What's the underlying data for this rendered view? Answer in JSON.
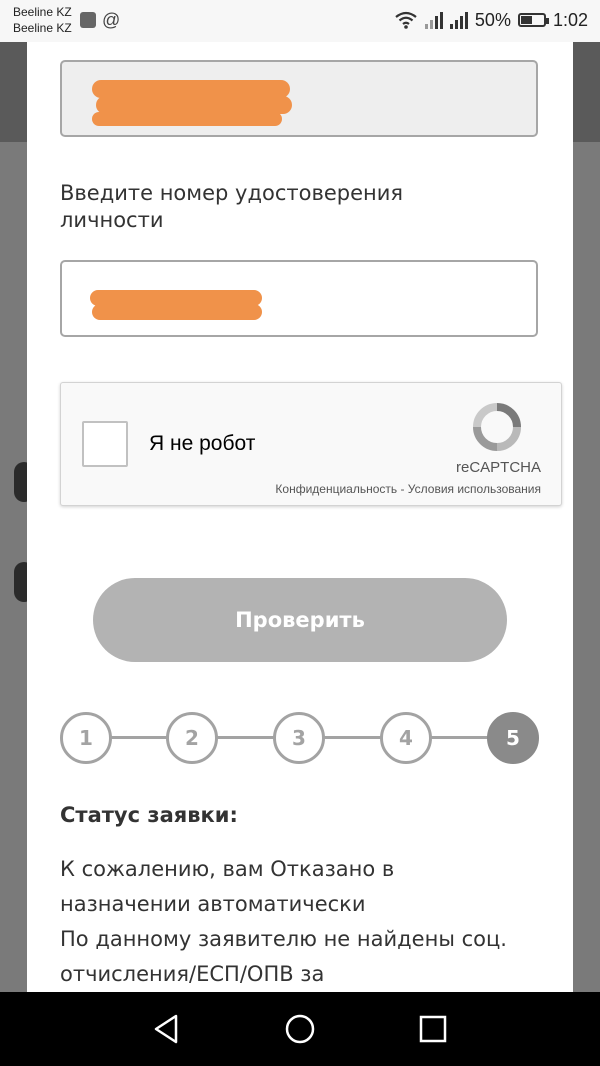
{
  "status_bar": {
    "carrier_1": "Beeline KZ",
    "carrier_2": "Beeline KZ",
    "at_symbol": "@",
    "battery_percent": "50%",
    "battery_level": 0.5,
    "time": "1:02",
    "icons": [
      "shield-icon",
      "wifi-icon",
      "cell-signal-icon",
      "battery-icon"
    ]
  },
  "form": {
    "id_label": "Введите номер удостоверения личности"
  },
  "captcha": {
    "label": "Я не робот",
    "brand": "reCAPTCHA",
    "links": "Конфиденциальность - Условия использования",
    "checked": false
  },
  "check_button": {
    "label": "Проверить"
  },
  "steps": {
    "items": [
      "1",
      "2",
      "3",
      "4",
      "5"
    ],
    "active": "5"
  },
  "status": {
    "title": "Статус заявки:",
    "line_1": "К сожалению, вам Отказано в назначении автоматически",
    "line_2": "По данному заявителю не найдены соц. отчисления/ЕСП/ОПВ за"
  },
  "colors": {
    "redaction": "#f0924a",
    "button_disabled": "#b3b3b3",
    "step_active": "#8a8a8a",
    "step_inactive": "#a3a3a3"
  },
  "nav_bar": {
    "icons": [
      "back-icon",
      "home-icon",
      "recents-icon"
    ]
  }
}
